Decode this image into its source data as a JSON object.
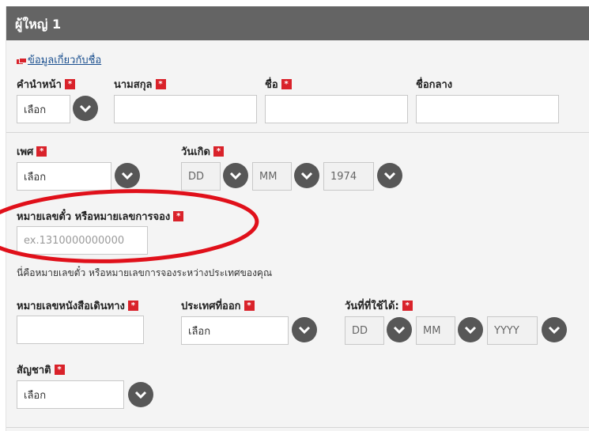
{
  "header": {
    "title": "ผู้ใหญ่ 1"
  },
  "info_link": "ข้อมูลเกี่ยวกับชื่อ",
  "required_mark": "*",
  "fields": {
    "title": {
      "label": "คำนำหน้า",
      "value": "เลือก"
    },
    "surname": {
      "label": "นามสกุล",
      "value": ""
    },
    "first_name": {
      "label": "ชื่อ",
      "value": ""
    },
    "middle_name": {
      "label": "ชื่อกลาง",
      "value": ""
    },
    "gender": {
      "label": "เพศ",
      "value": "เลือก"
    },
    "dob": {
      "label": "วันเกิด",
      "day": "DD",
      "month": "MM",
      "year": "1974"
    },
    "ticket": {
      "label": "หมายเลขตั๋ว หรือหมายเลขการจอง",
      "placeholder": "ex.1310000000000",
      "help": "นี่คือหมายเลขตั๋ว หรือหมายเลขการจองระหว่างประเทศของคุณ"
    },
    "passport": {
      "label": "หมายเลขหนังสือเดินทาง",
      "value": ""
    },
    "issuing_country": {
      "label": "ประเทศที่ออก",
      "value": "เลือก"
    },
    "expiry": {
      "label": "วันที่ที่ใช้ได้:",
      "day": "DD",
      "month": "MM",
      "year": "YYYY"
    },
    "nationality": {
      "label": "สัญชาติ",
      "value": "เลือก"
    }
  },
  "colors": {
    "header": "#646464",
    "required": "#d9222a",
    "annotation": "#e0101a",
    "link": "#1a4f8f"
  },
  "icons": {
    "chevron": "chevron-down-icon",
    "info": "info-icon"
  }
}
